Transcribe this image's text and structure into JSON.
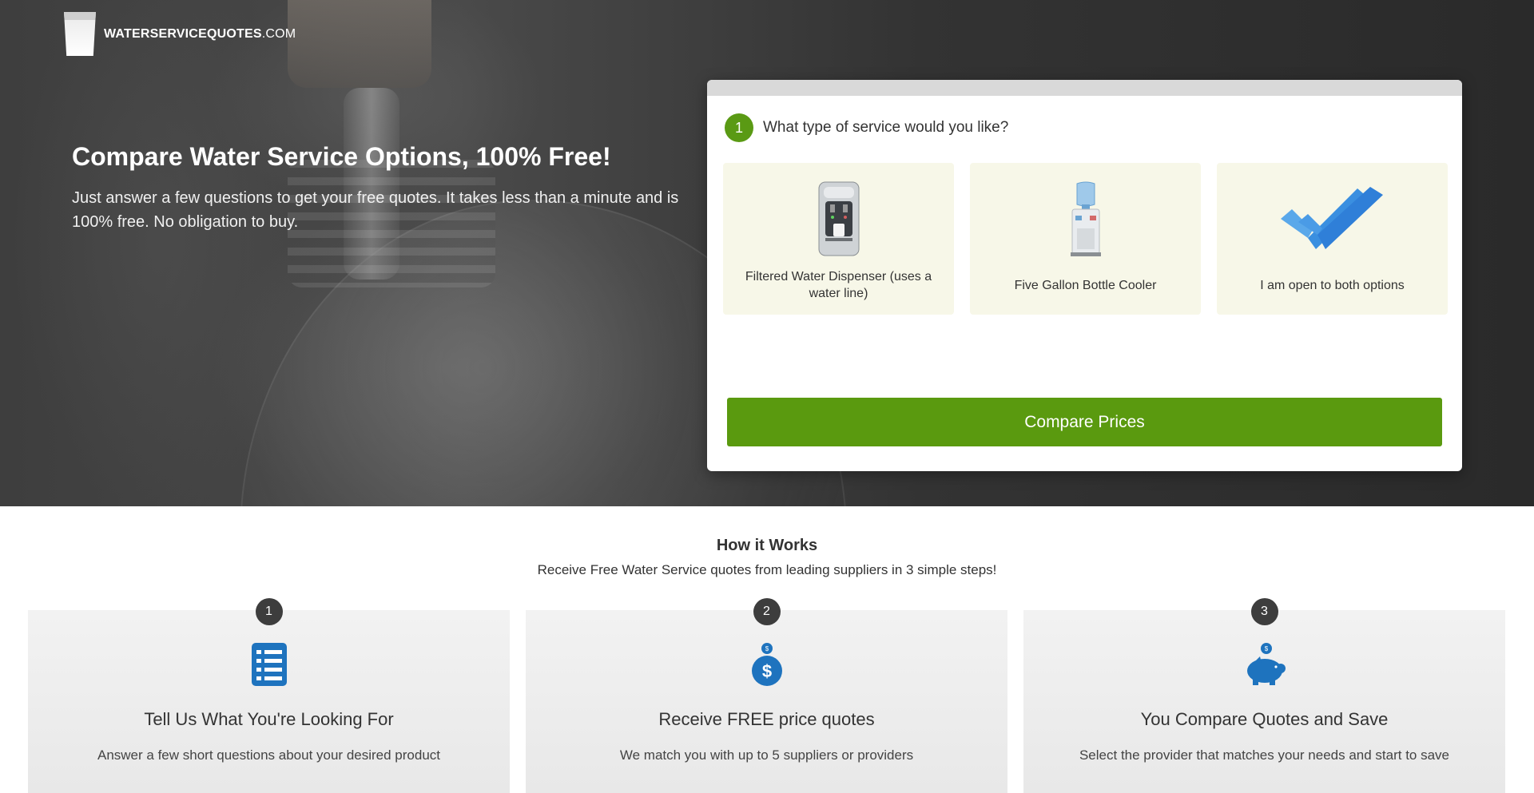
{
  "brand": {
    "name_bold": "WATERSERVICEQUOTES",
    "name_suffix": ".COM"
  },
  "hero": {
    "title": "Compare Water Service Options, 100% Free!",
    "subtitle": "Just answer a few questions to get your free quotes. It takes less than a minute and is 100% free. No obligation to buy."
  },
  "quote_form": {
    "step_number": "1",
    "question": "What type of service would you like?",
    "options": [
      {
        "label": "Filtered Water Dispenser (uses a water line)",
        "icon": "water-dispenser-icon"
      },
      {
        "label": "Five Gallon Bottle Cooler",
        "icon": "bottle-cooler-icon"
      },
      {
        "label": "I am open to both options",
        "icon": "double-check-icon"
      }
    ],
    "submit_label": "Compare Prices"
  },
  "how_it_works": {
    "title": "How it Works",
    "subtitle": "Receive Free Water Service quotes from leading suppliers in 3 simple steps!",
    "steps": [
      {
        "number": "1",
        "icon": "checklist-icon",
        "heading": "Tell Us What You're Looking For",
        "text": "Answer a few short questions about your desired product"
      },
      {
        "number": "2",
        "icon": "money-bag-icon",
        "heading": "Receive FREE price quotes",
        "text": "We match you with up to 5 suppliers or providers"
      },
      {
        "number": "3",
        "icon": "piggy-bank-icon",
        "heading": "You Compare Quotes and Save",
        "text": "Select the provider that matches your needs and start to save"
      }
    ]
  },
  "colors": {
    "accent_green": "#5a9a0f",
    "icon_blue": "#1e73be",
    "step_dark": "#3d3d3d",
    "option_bg": "#f7f7e8"
  }
}
